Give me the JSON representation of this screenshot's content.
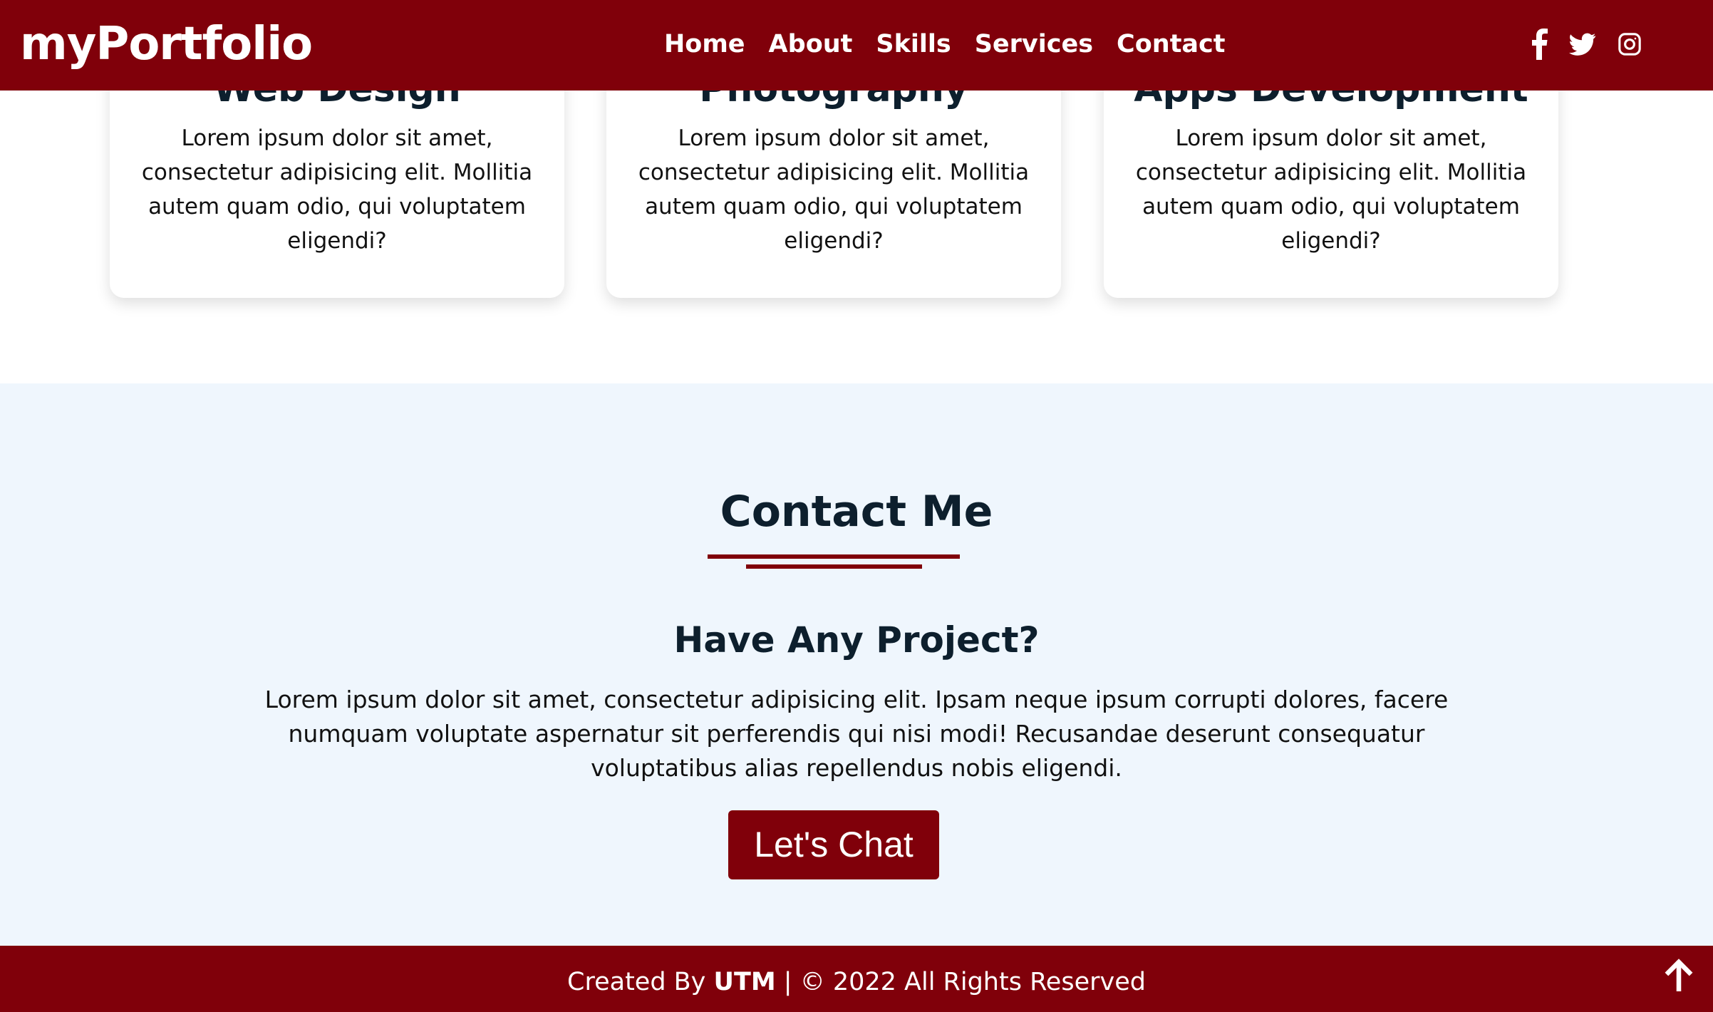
{
  "header": {
    "logo": "myPortfolio",
    "nav": [
      "Home",
      "About",
      "Skills",
      "Services",
      "Contact"
    ],
    "social_icons": [
      "facebook-icon",
      "twitter-icon",
      "instagram-icon"
    ]
  },
  "services": {
    "cards": [
      {
        "title": "Web Design",
        "text": "Lorem ipsum dolor sit amet, consectetur adipisicing elit. Mollitia autem quam odio, qui voluptatem eligendi?"
      },
      {
        "title": "Photography",
        "text": "Lorem ipsum dolor sit amet, consectetur adipisicing elit. Mollitia autem quam odio, qui voluptatem eligendi?"
      },
      {
        "title": "Apps Development",
        "text": "Lorem ipsum dolor sit amet, consectetur adipisicing elit. Mollitia autem quam odio, qui voluptatem eligendi?"
      }
    ]
  },
  "contact": {
    "heading": "Contact Me",
    "subheading": "Have Any Project?",
    "text": "Lorem ipsum dolor sit amet, consectetur adipisicing elit. Ipsam neque ipsum corrupti dolores, facere numquam voluptate aspernatur sit perferendis qui nisi modi! Recusandae deserunt consequatur voluptatibus alias repellendus nobis eligendi.",
    "button_label": "Let's Chat"
  },
  "footer": {
    "prefix": "Created By ",
    "author": "UTM",
    "suffix": " | © 2022 All Rights Reserved",
    "scroll_icon": "arrow-up-icon"
  },
  "colors": {
    "brand": "#80000a",
    "section_bg": "#eff6fd",
    "heading": "#0d1f2d"
  }
}
